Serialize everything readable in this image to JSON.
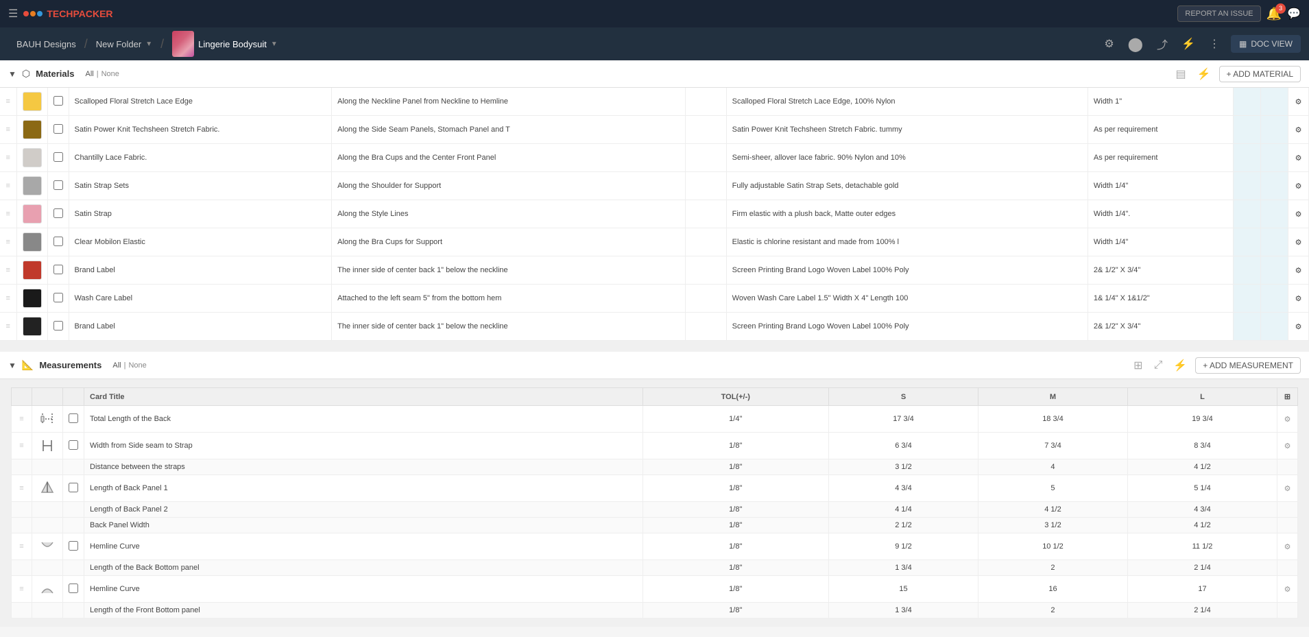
{
  "topNav": {
    "brand": "TECHPACKER",
    "reportIssue": "REPORT AN ISSUE",
    "notifCount": "3"
  },
  "breadcrumb": {
    "workspace": "BAUH Designs",
    "folder": "New Folder",
    "product": "Lingerie Bodysuit",
    "docView": "DOC VIEW"
  },
  "materials": {
    "sectionTitle": "Materials",
    "filterAll": "All",
    "filterNone": "None",
    "addLabel": "+ ADD MATERIAL",
    "rows": [
      {
        "name": "Scalloped Floral Stretch Lace Edge",
        "placement": "Along the Neckline Panel from Neckline to Hemline",
        "detail": "Scalloped Floral Stretch Lace Edge, 100% Nylon",
        "qty": "Width 1\"",
        "swatch": "swatch-yellow"
      },
      {
        "name": "Satin Power Knit Techsheen Stretch Fabric.",
        "placement": "Along the Side Seam Panels, Stomach Panel and T",
        "detail": "Satin Power Knit Techsheen Stretch Fabric. tummy",
        "qty": "As per requirement",
        "swatch": "swatch-brown"
      },
      {
        "name": "Chantilly Lace Fabric.",
        "placement": "Along the Bra Cups and the Center Front Panel",
        "detail": "Semi-sheer, allover lace fabric. 90% Nylon and 10%",
        "qty": "As per requirement",
        "swatch": "swatch-lace"
      },
      {
        "name": "Satin Strap Sets",
        "placement": "Along the Shoulder for Support",
        "detail": "Fully adjustable Satin Strap Sets, detachable gold",
        "qty": "Width 1/4\"",
        "swatch": "swatch-gray"
      },
      {
        "name": "Satin Strap",
        "placement": "Along the Style Lines",
        "detail": "Firm elastic with a plush back, Matte outer edges",
        "qty": "Width 1/4\".",
        "swatch": "swatch-satin"
      },
      {
        "name": "Clear Mobilon Elastic",
        "placement": "Along the Bra Cups for Support",
        "detail": "Elastic is chlorine resistant and made from 100% l",
        "qty": "Width 1/4\"",
        "swatch": "swatch-elastic"
      },
      {
        "name": "Brand Label",
        "placement": "The inner side of center back 1\" below the neckline",
        "detail": "Screen Printing Brand Logo Woven Label 100% Poly",
        "qty": "2& 1/2\"  X 3/4\"",
        "swatch": "swatch-red"
      },
      {
        "name": "Wash Care Label",
        "placement": "Attached to the left seam 5\" from the bottom hem",
        "detail": "Woven Wash Care Label 1.5\" Width X 4\" Length 100",
        "qty": "1& 1/4\" X 1&1/2\"",
        "swatch": "swatch-black"
      },
      {
        "name": "Brand Label",
        "placement": "The inner side of center back 1\" below the neckline",
        "detail": "Screen Printing Brand Logo Woven Label 100% Poly",
        "qty": "2& 1/2\"  X 3/4\"",
        "swatch": "swatch-dark"
      }
    ]
  },
  "measurements": {
    "sectionTitle": "Measurements",
    "filterAll": "All",
    "filterNone": "None",
    "addLabel": "+ ADD MEASUREMENT",
    "colCardTitle": "Card Title",
    "colTol": "TOL(+/-)",
    "colS": "S",
    "colM": "M",
    "colL": "L",
    "groups": [
      {
        "iconType": "back-length",
        "rows": [
          {
            "main": true,
            "label": "Total Length of the Back",
            "tol": "1/4\"",
            "s": "17 3/4",
            "m": "18 3/4",
            "l": "19 3/4",
            "hasGear": true
          }
        ]
      },
      {
        "iconType": "strap-width",
        "rows": [
          {
            "main": true,
            "label": "Width from Side seam to Strap",
            "tol": "1/8\"",
            "s": "6 3/4",
            "m": "7 3/4",
            "l": "8 3/4",
            "hasGear": true
          },
          {
            "main": false,
            "label": "Distance between the straps",
            "tol": "1/8\"",
            "s": "3 1/2",
            "m": "4",
            "l": "4 1/2",
            "hasGear": false
          }
        ]
      },
      {
        "iconType": "back-panel",
        "rows": [
          {
            "main": true,
            "label": "Length of Back Panel 1",
            "tol": "1/8\"",
            "s": "4 3/4",
            "m": "5",
            "l": "5 1/4",
            "hasGear": true
          },
          {
            "main": false,
            "label": "Length of Back Panel 2",
            "tol": "1/8\"",
            "s": "4 1/4",
            "m": "4 1/2",
            "l": "4 3/4",
            "hasGear": false
          },
          {
            "main": false,
            "label": "Back Panel Width",
            "tol": "1/8\"",
            "s": "2 1/2",
            "m": "3 1/2",
            "l": "4 1/2",
            "hasGear": false
          }
        ]
      },
      {
        "iconType": "hemline-back",
        "rows": [
          {
            "main": true,
            "label": "Hemline Curve",
            "tol": "1/8\"",
            "s": "9 1/2",
            "m": "10 1/2",
            "l": "11 1/2",
            "hasGear": true
          },
          {
            "main": false,
            "label": "Length of the Back Bottom panel",
            "tol": "1/8\"",
            "s": "1 3/4",
            "m": "2",
            "l": "2 1/4",
            "hasGear": false
          }
        ]
      },
      {
        "iconType": "hemline-front",
        "rows": [
          {
            "main": true,
            "label": "Hemline Curve",
            "tol": "1/8\"",
            "s": "15",
            "m": "16",
            "l": "17",
            "hasGear": true
          },
          {
            "main": false,
            "label": "Length of the Front Bottom panel",
            "tol": "1/8\"",
            "s": "1 3/4",
            "m": "2",
            "l": "2 1/4",
            "hasGear": false
          }
        ]
      }
    ]
  }
}
